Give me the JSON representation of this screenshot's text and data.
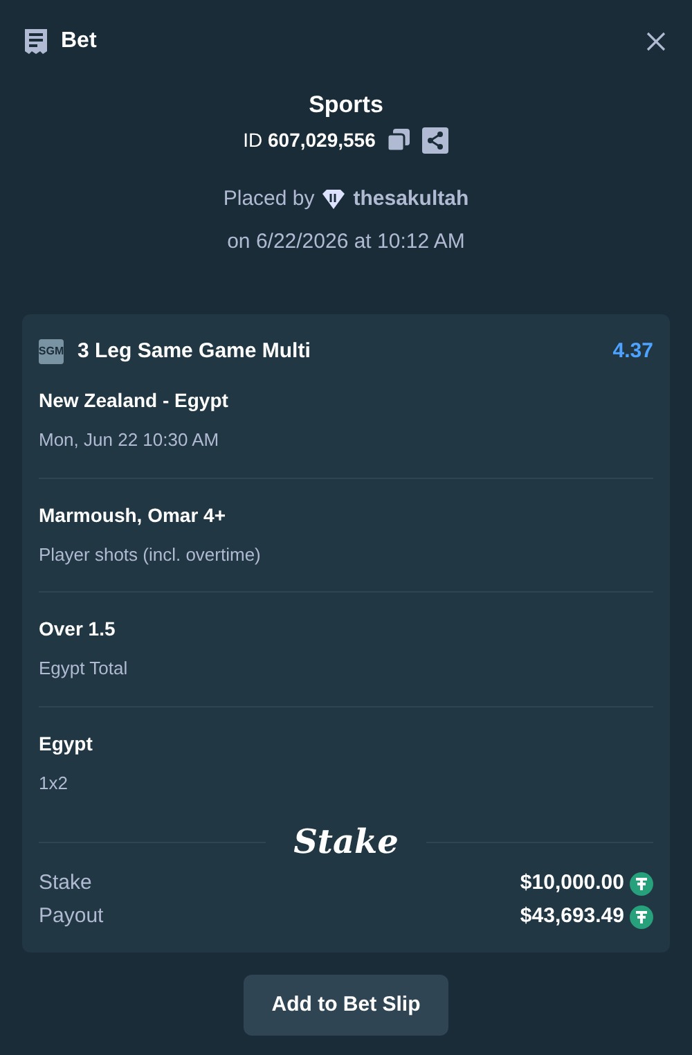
{
  "header": {
    "title": "Bet"
  },
  "bet": {
    "category": "Sports",
    "id_label": "ID",
    "id": "607,029,556",
    "placed_by": "Placed by",
    "user": "thesakultah",
    "placed_on": "on 6/22/2026 at 10:12 AM"
  },
  "card": {
    "badge": "SGM",
    "title": "3 Leg Same Game Multi",
    "odds": "4.37",
    "legs": [
      {
        "title": "New Zealand - Egypt",
        "subtitle": "Mon, Jun 22 10:30 AM"
      },
      {
        "title": "Marmoush, Omar 4+",
        "subtitle": "Player shots (incl. overtime)"
      },
      {
        "title": "Over 1.5",
        "subtitle": "Egypt Total"
      },
      {
        "title": "Egypt",
        "subtitle": "1x2"
      }
    ],
    "logo": "Stake",
    "totals": [
      {
        "label": "Stake",
        "amount": "$10,000.00"
      },
      {
        "label": "Payout",
        "amount": "$43,693.49"
      }
    ]
  },
  "action": "Add to Bet Slip"
}
